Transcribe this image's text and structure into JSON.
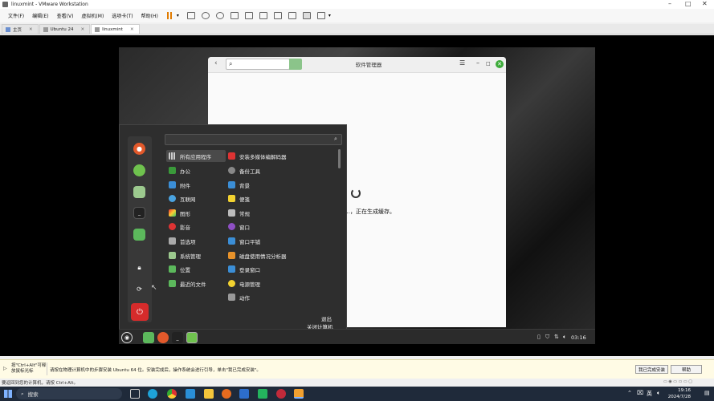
{
  "window": {
    "title": "linuxmint - VMware Workstation"
  },
  "menubar": {
    "items": [
      "文件(F)",
      "编辑(E)",
      "查看(V)",
      "虚拟机(M)",
      "选项卡(T)",
      "帮助(H)"
    ]
  },
  "tabs": [
    {
      "label": "主页"
    },
    {
      "label": "Ubuntu 24"
    },
    {
      "label": "linuxmint"
    }
  ],
  "software_manager": {
    "title": "软件管理器",
    "status": "…，正在生成缓存。"
  },
  "start_menu": {
    "categories": [
      "所有应用程序",
      "办公",
      "附件",
      "互联网",
      "图形",
      "影音",
      "首选项",
      "系统管理",
      "位置",
      "最近的文件"
    ],
    "apps": [
      "安装多媒体编解码器",
      "备份工具",
      "背景",
      "便笺",
      "常规",
      "窗口",
      "窗口平铺",
      "磁盘使用情况分析器",
      "登录窗口",
      "电源管理",
      "动作"
    ],
    "logout": "退出",
    "shutdown": "关闭计算机"
  },
  "guest_panel": {
    "clock": "03:16"
  },
  "hint_bar": {
    "hint_left": "按\"Ctrl+Alt\"可释放鼠标光标",
    "hint_main": "请按在物理计算机中的步骤安装 Ubuntu 64 位。安装完成后，操作系统会进行引导，单击\"我已完成安装\"。",
    "done_button": "我已完成安装",
    "help_button": "帮助"
  },
  "status_bar": {
    "text": "要返回到您的计算机，请按 Ctrl+Alt。"
  },
  "win_taskbar": {
    "search": "搜索",
    "time": "19:16",
    "date": "2024/7/28",
    "ime": "英"
  },
  "colors": {
    "accent": "#3dab3a",
    "menu_bg": "#2e2e2e",
    "taskbar": "#1f2a3a"
  }
}
